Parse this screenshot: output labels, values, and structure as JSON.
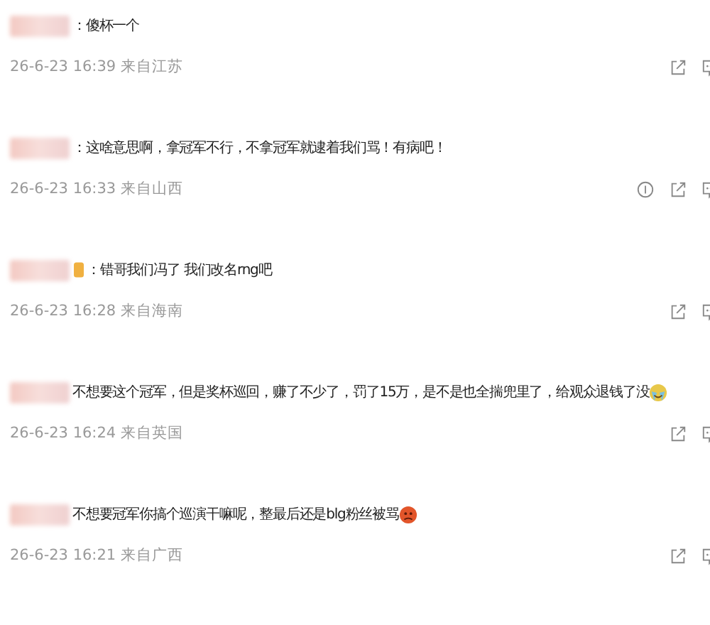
{
  "comments": [
    {
      "text": "：傻杯一个",
      "meta": "26-6-23 16:39 来自江苏",
      "vip_badge": false,
      "info_icon": false
    },
    {
      "text": "：这啥意思啊，拿冠军不行，不拿冠军就逮着我们骂！有病吧！",
      "meta": "26-6-23 16:33 来自山西",
      "vip_badge": false,
      "info_icon": true
    },
    {
      "text": "：错哥我们冯了 我们改名rng吧",
      "meta": "26-6-23 16:28 来自海南",
      "vip_badge": true,
      "info_icon": false
    },
    {
      "text": "不想要这个冠军，但是奖杯巡回，赚了不少了，罚了15万，是不是也全揣兜里了，给观众退钱了没",
      "meta": "26-6-23 16:24 来自英国",
      "vip_badge": false,
      "info_icon": false,
      "emoji": {
        "kind": "crying"
      }
    },
    {
      "text": "不想要冠军你搞个巡演干嘛呢，整最后还是blg粉丝被骂",
      "meta": "26-6-23 16:21 来自广西",
      "vip_badge": false,
      "info_icon": false,
      "emoji": {
        "kind": "angry"
      }
    }
  ]
}
